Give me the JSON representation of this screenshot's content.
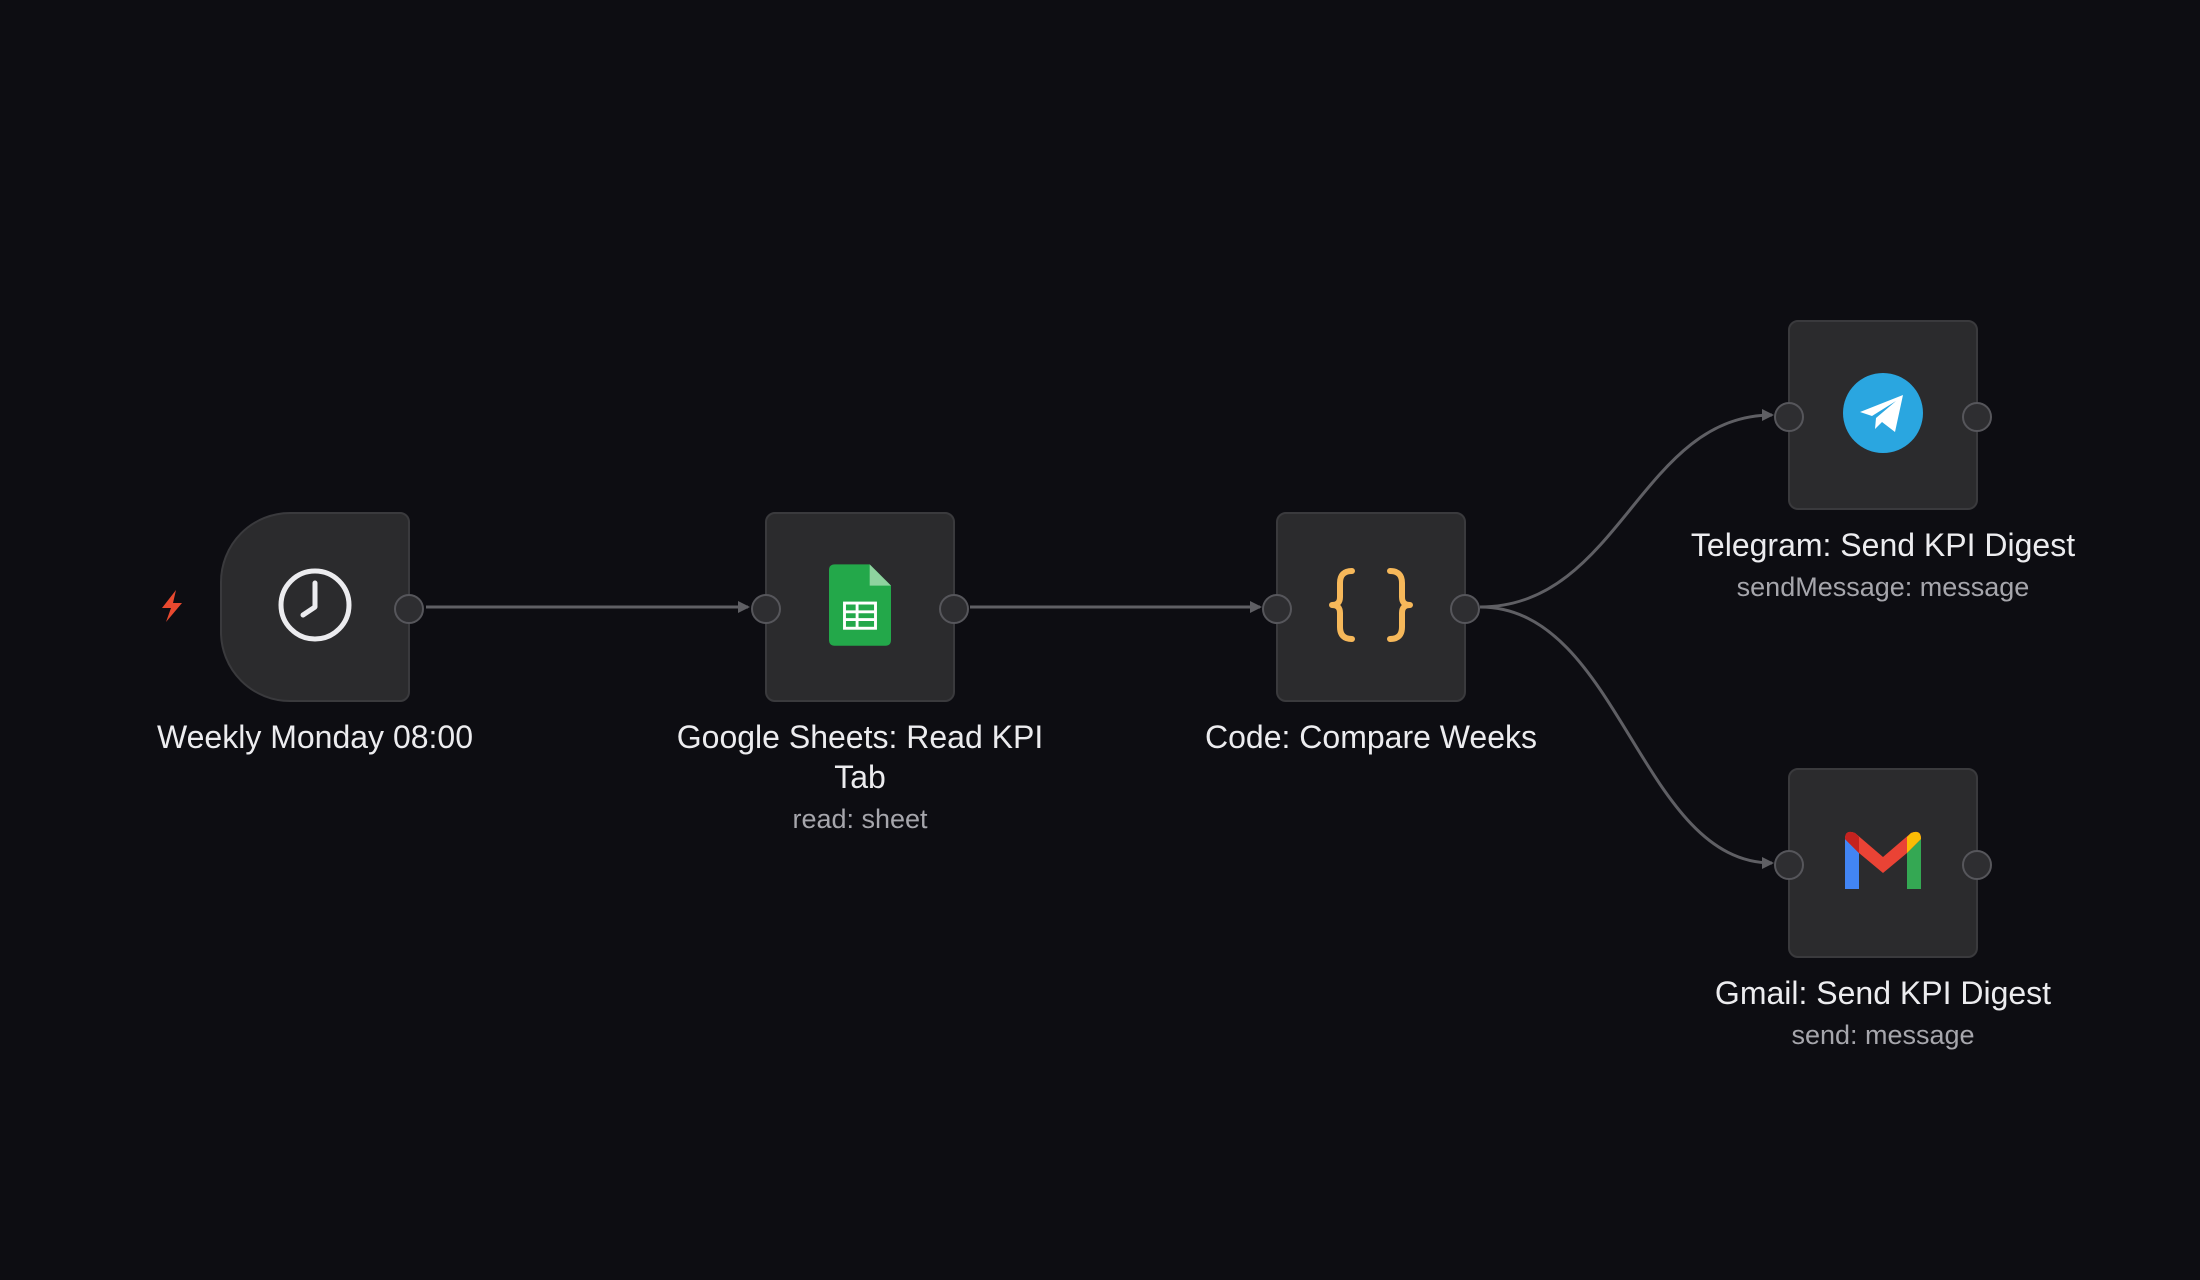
{
  "workflow": {
    "nodes": [
      {
        "id": "trigger",
        "title": "Weekly Monday 08:00",
        "subtitle": "",
        "icon": "clock-icon"
      },
      {
        "id": "sheets",
        "title": "Google Sheets: Read KPI Tab",
        "subtitle": "read: sheet",
        "icon": "google-sheets-icon"
      },
      {
        "id": "code",
        "title": "Code: Compare Weeks",
        "subtitle": "",
        "icon": "code-braces-icon"
      },
      {
        "id": "telegram",
        "title": "Telegram: Send KPI Digest",
        "subtitle": "sendMessage: message",
        "icon": "telegram-icon"
      },
      {
        "id": "gmail",
        "title": "Gmail: Send KPI Digest",
        "subtitle": "send: message",
        "icon": "gmail-icon"
      }
    ],
    "connections": [
      {
        "from": "Weekly Monday 08:00",
        "to": "Google Sheets: Read KPI Tab"
      },
      {
        "from": "Google Sheets: Read KPI Tab",
        "to": "Code: Compare Weeks"
      },
      {
        "from": "Code: Compare Weeks",
        "to": "Telegram: Send KPI Digest"
      },
      {
        "from": "Code: Compare Weeks",
        "to": "Gmail: Send KPI Digest"
      }
    ]
  },
  "colors": {
    "background": "#0d0d12",
    "node_fill": "#2b2b2d",
    "edge": "#5f5f64",
    "trigger_bolt": "#e8492f",
    "code_braces": "#f6b85a",
    "sheets_green": "#23a84a",
    "telegram_blue": "#2aa6e0"
  }
}
